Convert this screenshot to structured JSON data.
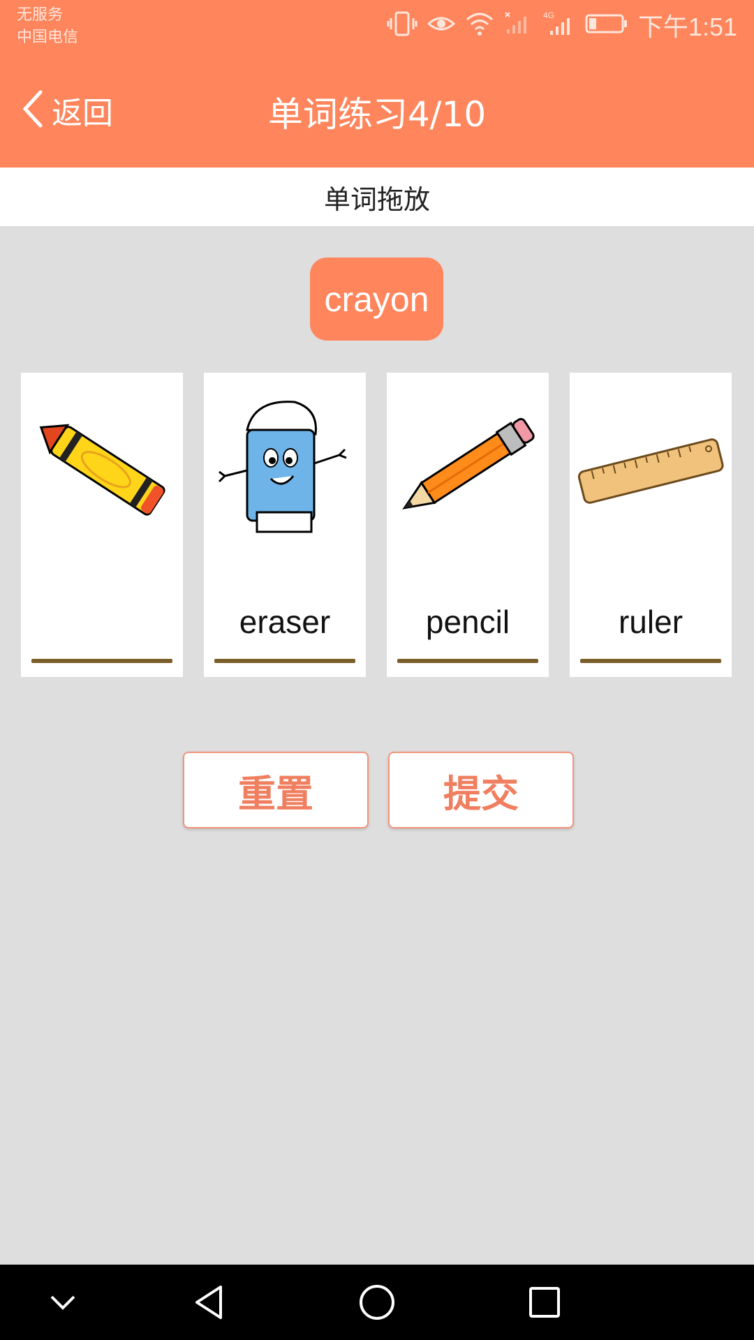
{
  "status_bar": {
    "carrier_line1": "无服务",
    "carrier_line2": "中国电信",
    "time": "下午1:51",
    "icons": [
      "vibrate-icon",
      "eye-icon",
      "wifi-icon",
      "signal-empty-icon",
      "signal-4g-icon",
      "battery-icon"
    ]
  },
  "header": {
    "back_label": "返回",
    "title": "单词练习4/10",
    "background_color": "#ff855c"
  },
  "subheader": {
    "label": "单词拖放"
  },
  "drag_word": {
    "text": "crayon"
  },
  "cards": [
    {
      "picture": "crayon",
      "answer": ""
    },
    {
      "picture": "eraser",
      "answer": "eraser"
    },
    {
      "picture": "pencil",
      "answer": "pencil"
    },
    {
      "picture": "ruler",
      "answer": "ruler"
    }
  ],
  "buttons": {
    "reset": "重置",
    "submit": "提交"
  },
  "nav": [
    "collapse-icon",
    "back-triangle-icon",
    "home-circle-icon",
    "recents-square-icon"
  ]
}
